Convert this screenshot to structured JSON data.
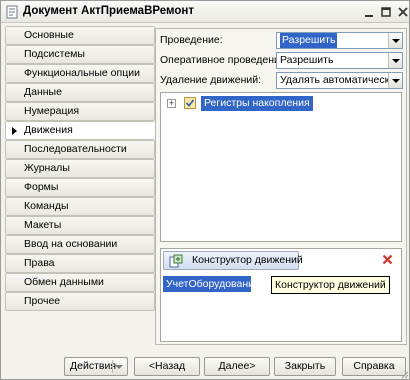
{
  "window": {
    "title": "Документ АктПриемаВРемонт"
  },
  "tabs": [
    {
      "label": "Основные",
      "active": false
    },
    {
      "label": "Подсистемы",
      "active": false
    },
    {
      "label": "Функциональные опции",
      "active": false
    },
    {
      "label": "Данные",
      "active": false
    },
    {
      "label": "Нумерация",
      "active": false
    },
    {
      "label": "Движения",
      "active": true
    },
    {
      "label": "Последовательности",
      "active": false
    },
    {
      "label": "Журналы",
      "active": false
    },
    {
      "label": "Формы",
      "active": false
    },
    {
      "label": "Команды",
      "active": false
    },
    {
      "label": "Макеты",
      "active": false
    },
    {
      "label": "Ввод на основании",
      "active": false
    },
    {
      "label": "Права",
      "active": false
    },
    {
      "label": "Обмен данными",
      "active": false
    },
    {
      "label": "Прочее",
      "active": false
    }
  ],
  "form": {
    "posting_label": "Проведение:",
    "posting_value": "Разрешить",
    "realtime_label": "Оперативное проведение:",
    "realtime_value": "Разрешить",
    "delete_label": "Удаление движений:",
    "delete_value": "Удалять автоматически при"
  },
  "tree": {
    "node_label": "Регистры накопления"
  },
  "movements": {
    "constructor_button": "Конструктор движений",
    "selected_item": "УчетОборудования",
    "tooltip": "Конструктор движений"
  },
  "footer": {
    "actions": "Действия",
    "back": "<Назад",
    "next": "Далее>",
    "close": "Закрыть",
    "help": "Справка"
  }
}
